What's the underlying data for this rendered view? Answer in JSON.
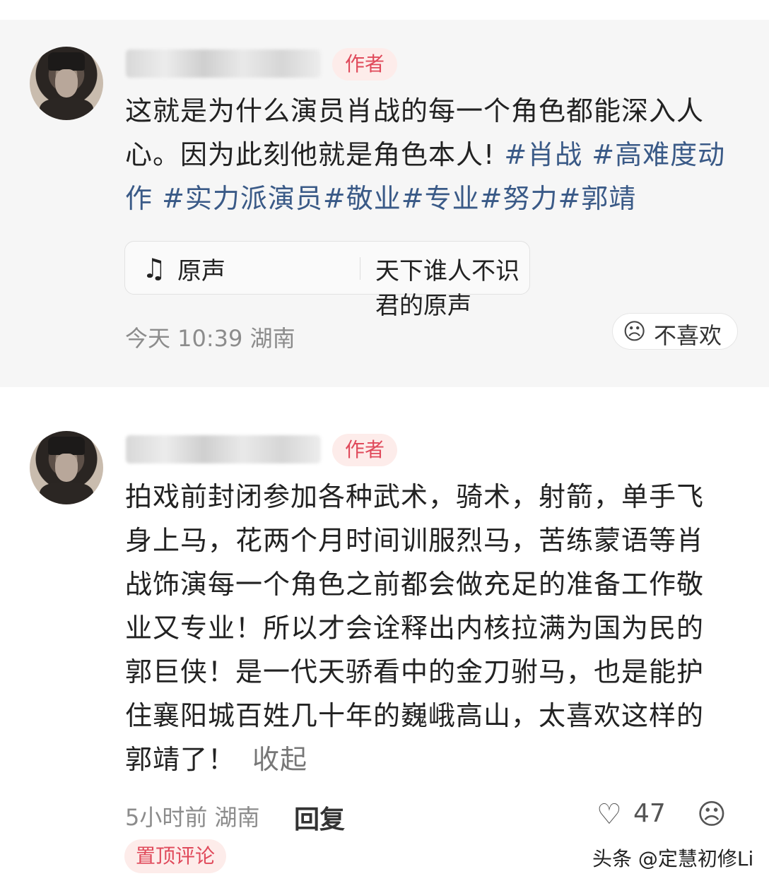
{
  "comments": [
    {
      "badge": "作者",
      "text_plain": "这就是为什么演员肖战的每一个角色都能深入人心。因为此刻他就是角色本人!",
      "hashtags_line1": " #肖战 #高难度动",
      "hashtags_line2": "作 #实力派演员#敬业#专业#努力#郭靖",
      "music_label": "原声",
      "music_song": "天下谁人不识君的原声",
      "time": "今天 10:39 湖南",
      "dislike_label": "不喜欢"
    },
    {
      "badge": "作者",
      "lines": [
        "拍戏前封闭参加各种武术，骑术，射箭，单手飞",
        "身上马，花两个月时间训服烈马，苦练蒙语等肖",
        "战饰演每一个角色之前都会做充足的准备工作敬",
        "业又专业！所以才会诠释出内核拉满为国为民的",
        "郭巨侠！是一代天骄看中的金刀驸马，也是能护",
        "住襄阳城百姓几十年的巍峨高山，太喜欢这样的",
        "郭靖了！"
      ],
      "collapse_label": "收起",
      "time": "5小时前 湖南",
      "reply_label": "回复",
      "like_count": "47",
      "pinned_label": "置顶评论"
    }
  ],
  "icons": {
    "music": "music-note-icon",
    "dislike": "sad-face-icon",
    "like": "heart-icon",
    "emoji": "sad-face-icon"
  },
  "watermark": "头条 @定慧初修Li",
  "colors": {
    "badge_text": "#e04a5b",
    "badge_bg": "#fdecea",
    "hashtag": "#3a5a87",
    "card_bg": "#f6f6f6"
  }
}
